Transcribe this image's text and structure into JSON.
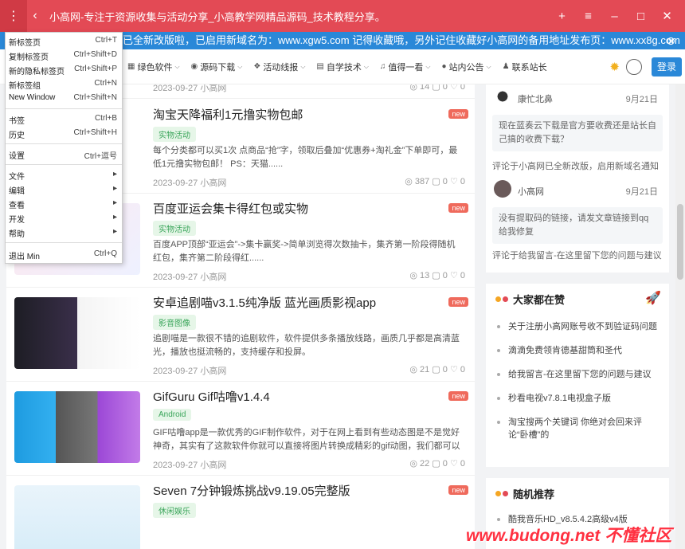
{
  "window": {
    "title": "小高网-专注于资源收集与活动分享_小高教学网精品源码_技术教程分享。",
    "menu_icon": "⋮",
    "back_icon": "‹",
    "controls": [
      "+",
      "≡",
      "–",
      "□",
      "✕"
    ]
  },
  "notice": {
    "text": "已全新改版啦，已启用新域名为：www.xgw5.com 记得收藏哦，另外记住收藏好小高网的备用地址发布页：www.xx8g.com",
    "close_icon": "⊗"
  },
  "nav": {
    "items": [
      {
        "icon": "▦",
        "label": "绿色软件"
      },
      {
        "icon": "◉",
        "label": "源码下载"
      },
      {
        "icon": "❖",
        "label": "活动线报"
      },
      {
        "icon": "▤",
        "label": "自学技术"
      },
      {
        "icon": "♫",
        "label": "值得一看"
      },
      {
        "icon": "●",
        "label": "站内公告"
      },
      {
        "icon": "♟",
        "label": "联系站长"
      }
    ],
    "login_label": "登录"
  },
  "context_menu": {
    "items": [
      {
        "label": "新标签页",
        "shortcut": "Ctrl+T"
      },
      {
        "label": "复制标签页",
        "shortcut": "Ctrl+Shift+D"
      },
      {
        "label": "新的隐私标签页",
        "shortcut": "Ctrl+Shift+P"
      },
      {
        "label": "新标签组",
        "shortcut": "Ctrl+N"
      },
      {
        "label": "New Window",
        "shortcut": "Ctrl+Shift+N"
      },
      {
        "label": "书签",
        "shortcut": "Ctrl+B"
      },
      {
        "label": "历史",
        "shortcut": "Ctrl+Shift+H"
      },
      {
        "label": "设置",
        "shortcut": "Ctrl+逗号"
      },
      {
        "label": "文件",
        "shortcut": "▸"
      },
      {
        "label": "编辑",
        "shortcut": "▸"
      },
      {
        "label": "查看",
        "shortcut": "▸"
      },
      {
        "label": "开发",
        "shortcut": "▸"
      },
      {
        "label": "帮助",
        "shortcut": "▸"
      },
      {
        "label": "退出 Min",
        "shortcut": "Ctrl+Q"
      }
    ]
  },
  "posts": [
    {
      "title": "",
      "tag": "",
      "desc": "",
      "date": "2023-09-27",
      "author": "小高网",
      "views": "14",
      "comments": "0",
      "likes": "0",
      "badge": ""
    },
    {
      "title": "淘宝天降福利1元撸实物包邮",
      "tag": "实物活动",
      "desc": "每个分类都可以买1次 点商品“抢”字，领取后叠加“优惠券+淘礼金”下单即可，最低1元撸实物包邮！ PS：天猫......",
      "date": "2023-09-27",
      "author": "小高网",
      "views": "387",
      "comments": "0",
      "likes": "0",
      "badge": "new"
    },
    {
      "title": "百度亚运会集卡得红包或实物",
      "tag": "实物活动",
      "desc": "百度APP顶部“亚运会”->集卡赢奖->简单浏览得次数抽卡，集齐第一阶段得随机红包，集齐第二阶段得红......",
      "date": "2023-09-27",
      "author": "小高网",
      "views": "13",
      "comments": "0",
      "likes": "0",
      "badge": "new"
    },
    {
      "title": "安卓追剧喵v3.1.5纯净版 蓝光画质影视app",
      "tag": "影音图像",
      "desc": "追剧喵是一款很不错的追剧软件，软件提供多条播放线路，画质几乎都是高清蓝光，播放也挺流畅的，支持缓存和投屏。",
      "date": "2023-09-27",
      "author": "小高网",
      "views": "21",
      "comments": "0",
      "likes": "0",
      "badge": "new"
    },
    {
      "title": "GifGuru Gif咕噜v1.4.4",
      "tag": "Android",
      "desc": "GIF咕噜app是一款优秀的GIF制作软件，对于在网上看到有些动态图是不是觉好神奇，其实有了这款软件你就可以直接将图片转换成精彩的gif动图，我们都可以使...",
      "date": "2023-09-27",
      "author": "小高网",
      "views": "22",
      "comments": "0",
      "likes": "0",
      "badge": "new"
    },
    {
      "title": "Seven 7分钟锻炼挑战v9.19.05完整版",
      "tag": "休闲娱乐",
      "desc": "",
      "date": "",
      "author": "",
      "views": "",
      "comments": "",
      "likes": "",
      "badge": "new"
    }
  ],
  "comments": [
    {
      "user": "康忙北鼻",
      "date": "9月21日",
      "text": "现在蓝奏云下载是官方要收费还是站长自己搞的收费下载？",
      "link": "评论于小高网已全新改版，启用新域名通知"
    },
    {
      "user": "小高网",
      "date": "9月21日",
      "text": "没有提取码的链接，请发文章链接到qq给我修复",
      "link": "评论于给我留言-在这里留下您的问题与建议"
    }
  ],
  "popular": {
    "heading": "大家都在赞",
    "items": [
      "关于注册小高网账号收不到验证码问题",
      "滴滴免费领肯德基甜筒和圣代",
      "给我留言-在这里留下您的问题与建议",
      "秒看电视v7.8.1电视盒子版",
      "淘宝搜两个关键词 你绝对会回来评论“卧槽”的"
    ]
  },
  "random": {
    "heading": "随机推荐",
    "items": [
      "酷我音乐HD_v8.5.4.2高级v4版"
    ]
  },
  "watermark": "www.budong.net 不懂社区",
  "colors": {
    "accent": "#e34a55",
    "blue": "#2a88d8",
    "tag_green": "#3aa55a",
    "new_badge": "#ef6a5c"
  }
}
